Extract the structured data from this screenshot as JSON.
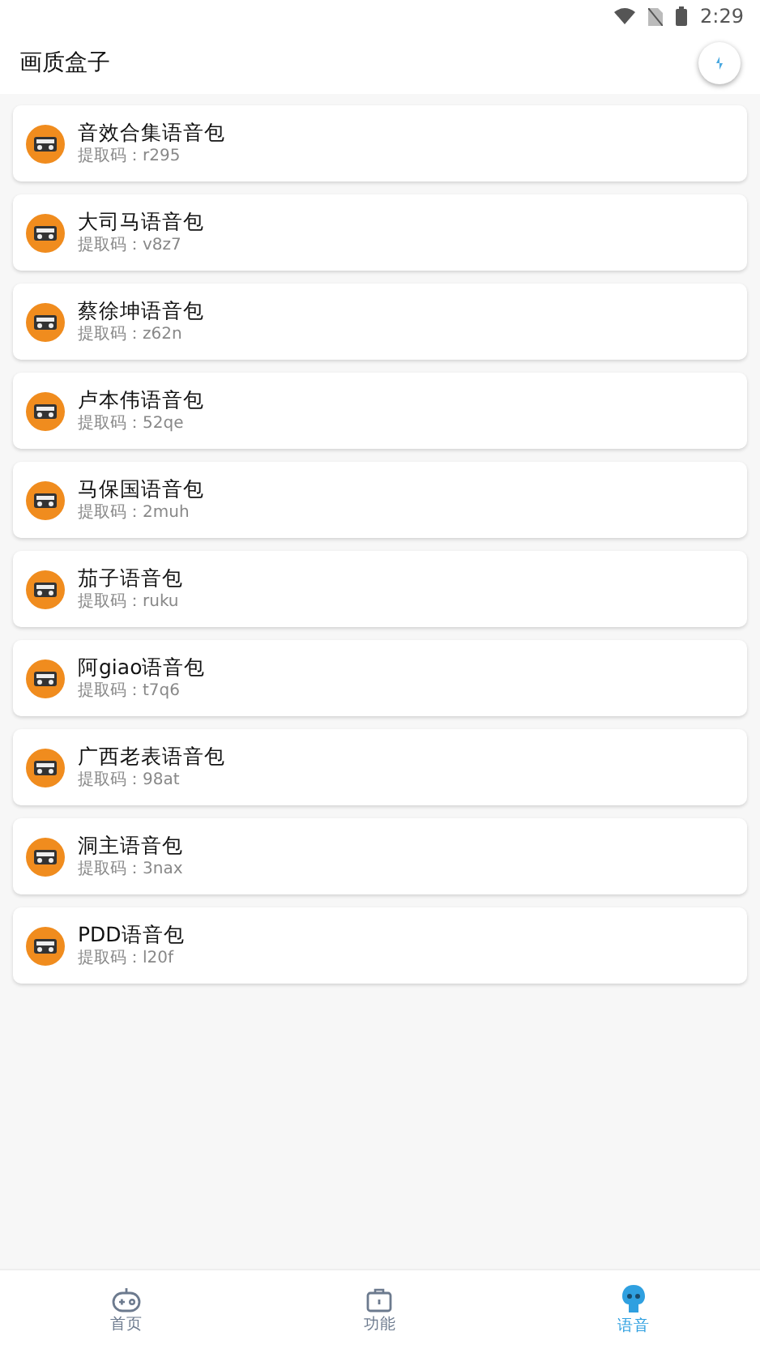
{
  "status_bar": {
    "time": "2:29"
  },
  "app_bar": {
    "title": "画质盒子"
  },
  "packs": [
    {
      "name": "音效合集语音包",
      "code": "提取码：r295"
    },
    {
      "name": "大司马语音包",
      "code": "提取码：v8z7"
    },
    {
      "name": "蔡徐坤语音包",
      "code": "提取码：z62n"
    },
    {
      "name": "卢本伟语音包",
      "code": "提取码：52qe"
    },
    {
      "name": "马保国语音包",
      "code": "提取码：2muh"
    },
    {
      "name": "茄子语音包",
      "code": "提取码：ruku"
    },
    {
      "name": "阿giao语音包",
      "code": "提取码：t7q6"
    },
    {
      "name": "广西老表语音包",
      "code": "提取码：98at"
    },
    {
      "name": "洞主语音包",
      "code": "提取码：3nax"
    },
    {
      "name": "PDD语音包",
      "code": "提取码：l20f"
    }
  ],
  "bottom_nav": [
    {
      "label": "首页",
      "kind": "gamepad",
      "selected": false
    },
    {
      "label": "功能",
      "kind": "toolbox",
      "selected": false
    },
    {
      "label": "语音",
      "kind": "robot",
      "selected": true
    }
  ]
}
